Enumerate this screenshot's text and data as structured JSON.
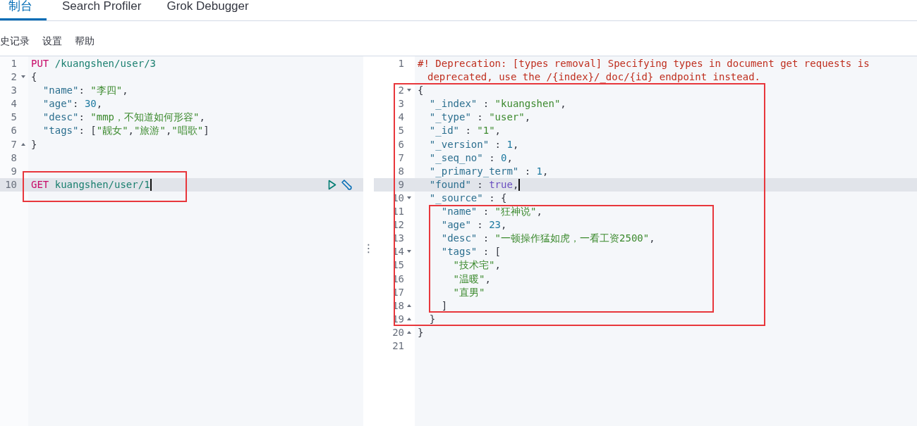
{
  "tabs": [
    {
      "label": "制台",
      "selected": true
    },
    {
      "label": "Search Profiler",
      "selected": false
    },
    {
      "label": "Grok Debugger",
      "selected": false
    }
  ],
  "toolbar": [
    "史记录",
    "设置",
    "帮助"
  ],
  "request_editor": {
    "lines": [
      {
        "num": "1",
        "fold_start": false,
        "fold_end": false,
        "active": false,
        "cursor": false,
        "tokens": [
          {
            "kind": "method",
            "text": "PUT"
          },
          {
            "kind": "url",
            "text": " /kuangshen/user/3"
          }
        ]
      },
      {
        "num": "2",
        "fold_start": true,
        "fold_end": false,
        "active": false,
        "cursor": false,
        "tokens": [
          {
            "kind": "punct",
            "text": "{"
          }
        ]
      },
      {
        "num": "3",
        "fold_start": false,
        "fold_end": false,
        "active": false,
        "cursor": false,
        "tokens": [
          {
            "kind": "key",
            "text": "  \"name\""
          },
          {
            "kind": "punct",
            "text": ": "
          },
          {
            "kind": "string",
            "text": "\"李四\""
          },
          {
            "kind": "punct",
            "text": ","
          }
        ]
      },
      {
        "num": "4",
        "fold_start": false,
        "fold_end": false,
        "active": false,
        "cursor": false,
        "tokens": [
          {
            "kind": "key",
            "text": "  \"age\""
          },
          {
            "kind": "punct",
            "text": ": "
          },
          {
            "kind": "number",
            "text": "30"
          },
          {
            "kind": "punct",
            "text": ","
          }
        ]
      },
      {
        "num": "5",
        "fold_start": false,
        "fold_end": false,
        "active": false,
        "cursor": false,
        "tokens": [
          {
            "kind": "key",
            "text": "  \"desc\""
          },
          {
            "kind": "punct",
            "text": ": "
          },
          {
            "kind": "string",
            "text": "\"mmp，不知道如何形容\""
          },
          {
            "kind": "punct",
            "text": ","
          }
        ]
      },
      {
        "num": "6",
        "fold_start": false,
        "fold_end": false,
        "active": false,
        "cursor": false,
        "tokens": [
          {
            "kind": "key",
            "text": "  \"tags\""
          },
          {
            "kind": "punct",
            "text": ": ["
          },
          {
            "kind": "string",
            "text": "\"靓女\""
          },
          {
            "kind": "punct",
            "text": ","
          },
          {
            "kind": "string",
            "text": "\"旅游\""
          },
          {
            "kind": "punct",
            "text": ","
          },
          {
            "kind": "string",
            "text": "\"唱歌\""
          },
          {
            "kind": "punct",
            "text": "]"
          }
        ]
      },
      {
        "num": "7",
        "fold_start": false,
        "fold_end": true,
        "active": false,
        "cursor": false,
        "tokens": [
          {
            "kind": "punct",
            "text": "}"
          }
        ]
      },
      {
        "num": "8",
        "fold_start": false,
        "fold_end": false,
        "active": false,
        "cursor": false
      },
      {
        "num": "9",
        "fold_start": false,
        "fold_end": false,
        "active": false,
        "cursor": false
      },
      {
        "num": "10",
        "fold_start": false,
        "fold_end": false,
        "active": true,
        "cursor": true,
        "tokens": [
          {
            "kind": "method",
            "text": "GET"
          },
          {
            "kind": "url",
            "text": " kuangshen/user/1"
          }
        ]
      }
    ],
    "actions": true
  },
  "resize_handle": "⋮",
  "response_editor": {
    "lines": [
      {
        "num": "1",
        "fold_start": false,
        "fold_end": false,
        "active": false,
        "cursor": false,
        "tokens": [
          {
            "kind": "comment",
            "text": "#! Deprecation: [types removal] Specifying types in document get requests is"
          }
        ],
        "continuation": "deprecated, use the /{index}/_doc/{id} endpoint instead."
      },
      {
        "num": "2",
        "fold_start": true,
        "fold_end": false,
        "active": false,
        "cursor": false,
        "tokens": [
          {
            "kind": "punct",
            "text": "{"
          }
        ]
      },
      {
        "num": "3",
        "fold_start": false,
        "fold_end": false,
        "active": false,
        "cursor": false,
        "tokens": [
          {
            "kind": "key",
            "text": "  \"_index\""
          },
          {
            "kind": "punct",
            "text": " : "
          },
          {
            "kind": "string",
            "text": "\"kuangshen\""
          },
          {
            "kind": "punct",
            "text": ","
          }
        ]
      },
      {
        "num": "4",
        "fold_start": false,
        "fold_end": false,
        "active": false,
        "cursor": false,
        "tokens": [
          {
            "kind": "key",
            "text": "  \"_type\""
          },
          {
            "kind": "punct",
            "text": " : "
          },
          {
            "kind": "string",
            "text": "\"user\""
          },
          {
            "kind": "punct",
            "text": ","
          }
        ]
      },
      {
        "num": "5",
        "fold_start": false,
        "fold_end": false,
        "active": false,
        "cursor": false,
        "tokens": [
          {
            "kind": "key",
            "text": "  \"_id\""
          },
          {
            "kind": "punct",
            "text": " : "
          },
          {
            "kind": "string",
            "text": "\"1\""
          },
          {
            "kind": "punct",
            "text": ","
          }
        ]
      },
      {
        "num": "6",
        "fold_start": false,
        "fold_end": false,
        "active": false,
        "cursor": false,
        "tokens": [
          {
            "kind": "key",
            "text": "  \"_version\""
          },
          {
            "kind": "punct",
            "text": " : "
          },
          {
            "kind": "number",
            "text": "1"
          },
          {
            "kind": "punct",
            "text": ","
          }
        ]
      },
      {
        "num": "7",
        "fold_start": false,
        "fold_end": false,
        "active": false,
        "cursor": false,
        "tokens": [
          {
            "kind": "key",
            "text": "  \"_seq_no\""
          },
          {
            "kind": "punct",
            "text": " : "
          },
          {
            "kind": "number",
            "text": "0"
          },
          {
            "kind": "punct",
            "text": ","
          }
        ]
      },
      {
        "num": "8",
        "fold_start": false,
        "fold_end": false,
        "active": false,
        "cursor": false,
        "tokens": [
          {
            "kind": "key",
            "text": "  \"_primary_term\""
          },
          {
            "kind": "punct",
            "text": " : "
          },
          {
            "kind": "number",
            "text": "1"
          },
          {
            "kind": "punct",
            "text": ","
          }
        ]
      },
      {
        "num": "9",
        "fold_start": false,
        "fold_end": false,
        "active": true,
        "cursor": true,
        "tokens": [
          {
            "kind": "key",
            "text": "  \"found\""
          },
          {
            "kind": "punct",
            "text": " : "
          },
          {
            "kind": "bool",
            "text": "true"
          },
          {
            "kind": "punct",
            "text": ","
          }
        ]
      },
      {
        "num": "10",
        "fold_start": true,
        "fold_end": false,
        "active": false,
        "cursor": false,
        "tokens": [
          {
            "kind": "key",
            "text": "  \"_source\""
          },
          {
            "kind": "punct",
            "text": " : {"
          }
        ]
      },
      {
        "num": "11",
        "fold_start": false,
        "fold_end": false,
        "active": false,
        "cursor": false,
        "tokens": [
          {
            "kind": "key",
            "text": "    \"name\""
          },
          {
            "kind": "punct",
            "text": " : "
          },
          {
            "kind": "string",
            "text": "\"狂神说\""
          },
          {
            "kind": "punct",
            "text": ","
          }
        ]
      },
      {
        "num": "12",
        "fold_start": false,
        "fold_end": false,
        "active": false,
        "cursor": false,
        "tokens": [
          {
            "kind": "key",
            "text": "    \"age\""
          },
          {
            "kind": "punct",
            "text": " : "
          },
          {
            "kind": "number",
            "text": "23"
          },
          {
            "kind": "punct",
            "text": ","
          }
        ]
      },
      {
        "num": "13",
        "fold_start": false,
        "fold_end": false,
        "active": false,
        "cursor": false,
        "tokens": [
          {
            "kind": "key",
            "text": "    \"desc\""
          },
          {
            "kind": "punct",
            "text": " : "
          },
          {
            "kind": "string",
            "text": "\"一顿操作猛如虎，一看工资2500\""
          },
          {
            "kind": "punct",
            "text": ","
          }
        ]
      },
      {
        "num": "14",
        "fold_start": true,
        "fold_end": false,
        "active": false,
        "cursor": false,
        "tokens": [
          {
            "kind": "key",
            "text": "    \"tags\""
          },
          {
            "kind": "punct",
            "text": " : ["
          }
        ]
      },
      {
        "num": "15",
        "fold_start": false,
        "fold_end": false,
        "active": false,
        "cursor": false,
        "tokens": [
          {
            "kind": "string",
            "text": "      \"技术宅\""
          },
          {
            "kind": "punct",
            "text": ","
          }
        ]
      },
      {
        "num": "16",
        "fold_start": false,
        "fold_end": false,
        "active": false,
        "cursor": false,
        "tokens": [
          {
            "kind": "string",
            "text": "      \"温暖\""
          },
          {
            "kind": "punct",
            "text": ","
          }
        ]
      },
      {
        "num": "17",
        "fold_start": false,
        "fold_end": false,
        "active": false,
        "cursor": false,
        "tokens": [
          {
            "kind": "string",
            "text": "      \"直男\""
          }
        ]
      },
      {
        "num": "18",
        "fold_start": false,
        "fold_end": true,
        "active": false,
        "cursor": false,
        "tokens": [
          {
            "kind": "punct",
            "text": "    ]"
          }
        ]
      },
      {
        "num": "19",
        "fold_start": false,
        "fold_end": true,
        "active": false,
        "cursor": false,
        "tokens": [
          {
            "kind": "punct",
            "text": "  }"
          }
        ]
      },
      {
        "num": "20",
        "fold_start": false,
        "fold_end": true,
        "active": false,
        "cursor": false,
        "tokens": [
          {
            "kind": "punct",
            "text": "}"
          }
        ]
      },
      {
        "num": "21",
        "fold_start": false,
        "fold_end": false,
        "active": false,
        "cursor": false
      }
    ]
  }
}
